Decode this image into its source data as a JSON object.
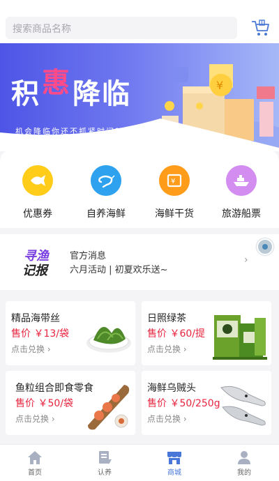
{
  "search": {
    "placeholder": "搜索商品名称"
  },
  "banner": {
    "title_part1": "积",
    "title_part2": "惠",
    "title_part3": "降临",
    "subtitle": "机会降临你还不抓紧时间？"
  },
  "categories": [
    {
      "label": "优惠券",
      "icon": "fish-coupon-icon",
      "color": "#ffcc1a"
    },
    {
      "label": "自养海鲜",
      "icon": "shrimp-icon",
      "color": "#2ea2ef"
    },
    {
      "label": "海鲜干货",
      "icon": "dried-seafood-icon",
      "color": "#ff9d1a"
    },
    {
      "label": "旅游船票",
      "icon": "ship-icon",
      "color": "#d38cf0"
    }
  ],
  "news": {
    "logo_line1": "寻渔",
    "logo_line2": "记报",
    "title": "官方消息",
    "subtitle": "六月活动 | 初夏欢乐送~",
    "arrow": "›"
  },
  "products": [
    {
      "name": "精品海带丝",
      "price": "售价 ￥13/袋",
      "action": "点击兑换",
      "image": "kelp-dish-image"
    },
    {
      "name": "日照绿茶",
      "price": "售价 ￥60/提",
      "action": "点击兑换",
      "image": "green-tea-box-image"
    },
    {
      "name": "鱼粒组合即食零食",
      "price": "售价 ￥50/袋",
      "action": "点击兑换",
      "image": "fish-snack-image"
    },
    {
      "name": "海鲜乌贼头",
      "price": "售价 ￥50/250g",
      "action": "点击兑换",
      "image": "squid-image"
    }
  ],
  "tabs": [
    {
      "label": "首页",
      "icon": "home-icon",
      "active": false
    },
    {
      "label": "认养",
      "icon": "adopt-icon",
      "active": false
    },
    {
      "label": "商城",
      "icon": "store-icon",
      "active": true
    },
    {
      "label": "我的",
      "icon": "user-icon",
      "active": false
    }
  ],
  "colors": {
    "accent": "#4877d9",
    "price": "#e9243e",
    "banner_start": "#4e55e6",
    "banner_end": "#a7b8f7"
  }
}
